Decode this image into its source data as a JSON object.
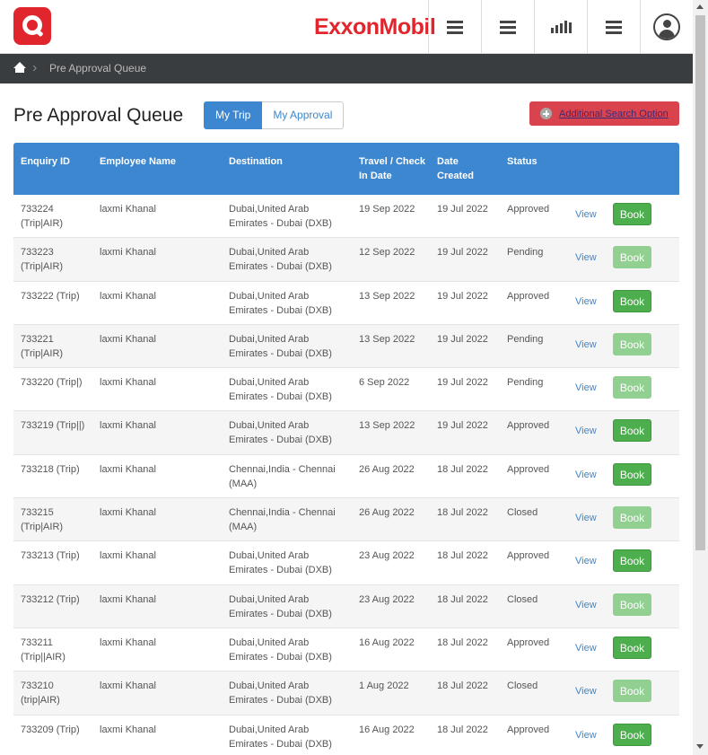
{
  "header": {
    "brand": "ExxonMobil",
    "icons": [
      "menu-icon",
      "list-icon",
      "chart-icon",
      "menu-icon",
      "user-icon"
    ]
  },
  "breadcrumb": {
    "current": "Pre Approval Queue"
  },
  "page": {
    "title": "Pre Approval Queue",
    "tab_my_trip": "My Trip",
    "tab_my_approval": "My Approval",
    "search_option": "Additional Search Option"
  },
  "colors": {
    "accent": "#3c87cf",
    "brand": "#e0262c",
    "book_enabled": "#4cae4c",
    "book_disabled": "#92d092",
    "search_button": "#d9434e"
  },
  "table": {
    "headers": {
      "enquiry_id": "Enquiry ID",
      "employee_name": "Employee Name",
      "destination": "Destination",
      "travel_date": "Travel / Check In Date",
      "date_created": "Date Created",
      "status": "Status"
    },
    "view_label": "View",
    "book_label": "Book",
    "rows": [
      {
        "id": "733224 (Trip|AIR)",
        "name": "laxmi Khanal",
        "dest": "Dubai,United Arab Emirates - Dubai (DXB)",
        "travel": "19 Sep 2022",
        "created": "19 Jul 2022",
        "status": "Approved",
        "book_enabled": true
      },
      {
        "id": "733223 (Trip|AIR)",
        "name": "laxmi Khanal",
        "dest": "Dubai,United Arab Emirates - Dubai (DXB)",
        "travel": "12 Sep 2022",
        "created": "19 Jul 2022",
        "status": "Pending",
        "book_enabled": false
      },
      {
        "id": "733222 (Trip)",
        "name": "laxmi Khanal",
        "dest": "Dubai,United Arab Emirates - Dubai (DXB)",
        "travel": "13 Sep 2022",
        "created": "19 Jul 2022",
        "status": "Approved",
        "book_enabled": true
      },
      {
        "id": "733221 (Trip|AIR)",
        "name": "laxmi Khanal",
        "dest": "Dubai,United Arab Emirates - Dubai (DXB)",
        "travel": "13 Sep 2022",
        "created": "19 Jul 2022",
        "status": "Pending",
        "book_enabled": false
      },
      {
        "id": "733220 (Trip|)",
        "name": "laxmi Khanal",
        "dest": "Dubai,United Arab Emirates - Dubai (DXB)",
        "travel": "6 Sep 2022",
        "created": "19 Jul 2022",
        "status": "Pending",
        "book_enabled": false
      },
      {
        "id": "733219 (Trip||)",
        "name": "laxmi Khanal",
        "dest": "Dubai,United Arab Emirates - Dubai (DXB)",
        "travel": "13 Sep 2022",
        "created": "19 Jul 2022",
        "status": "Approved",
        "book_enabled": true
      },
      {
        "id": "733218 (Trip)",
        "name": "laxmi Khanal",
        "dest": "Chennai,India - Chennai (MAA)",
        "travel": "26 Aug 2022",
        "created": "18 Jul 2022",
        "status": "Approved",
        "book_enabled": true
      },
      {
        "id": "733215 (Trip|AIR)",
        "name": "laxmi Khanal",
        "dest": "Chennai,India - Chennai (MAA)",
        "travel": "26 Aug 2022",
        "created": "18 Jul 2022",
        "status": "Closed",
        "book_enabled": false
      },
      {
        "id": "733213 (Trip)",
        "name": "laxmi Khanal",
        "dest": "Dubai,United Arab Emirates - Dubai (DXB)",
        "travel": "23 Aug 2022",
        "created": "18 Jul 2022",
        "status": "Approved",
        "book_enabled": true
      },
      {
        "id": "733212 (Trip)",
        "name": "laxmi Khanal",
        "dest": "Dubai,United Arab Emirates - Dubai (DXB)",
        "travel": "23 Aug 2022",
        "created": "18 Jul 2022",
        "status": "Closed",
        "book_enabled": false
      },
      {
        "id": "733211 (Trip||AIR)",
        "name": "laxmi Khanal",
        "dest": "Dubai,United Arab Emirates - Dubai (DXB)",
        "travel": "16 Aug 2022",
        "created": "18 Jul 2022",
        "status": "Approved",
        "book_enabled": true
      },
      {
        "id": "733210 (trip|AIR)",
        "name": "laxmi Khanal",
        "dest": "Dubai,United Arab Emirates - Dubai (DXB)",
        "travel": "1 Aug 2022",
        "created": "18 Jul 2022",
        "status": "Closed",
        "book_enabled": false
      },
      {
        "id": "733209 (Trip)",
        "name": "laxmi Khanal",
        "dest": "Dubai,United Arab Emirates - Dubai (DXB)",
        "travel": "16 Aug 2022",
        "created": "18 Jul 2022",
        "status": "Approved",
        "book_enabled": true
      }
    ]
  }
}
